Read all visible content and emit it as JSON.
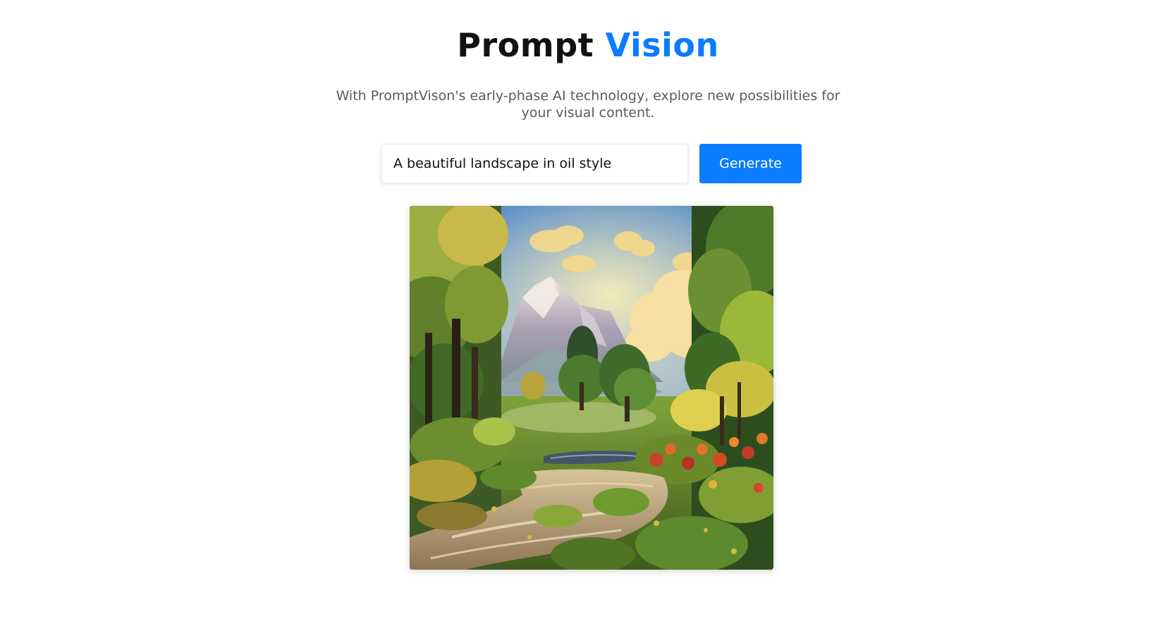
{
  "app": {
    "title_part1": "Prompt",
    "title_part2": "Vision",
    "subtitle": "With PromptVison's early-phase AI technology, explore new possibilities for your visual content."
  },
  "prompt": {
    "value": "A beautiful landscape in oil style"
  },
  "actions": {
    "generate_label": "Generate"
  },
  "result": {
    "image_alt": "A beautiful landscape in oil style"
  },
  "colors": {
    "accent": "#0a7cff",
    "subtitle_text": "#5a5a5a",
    "background": "#ffffff"
  }
}
